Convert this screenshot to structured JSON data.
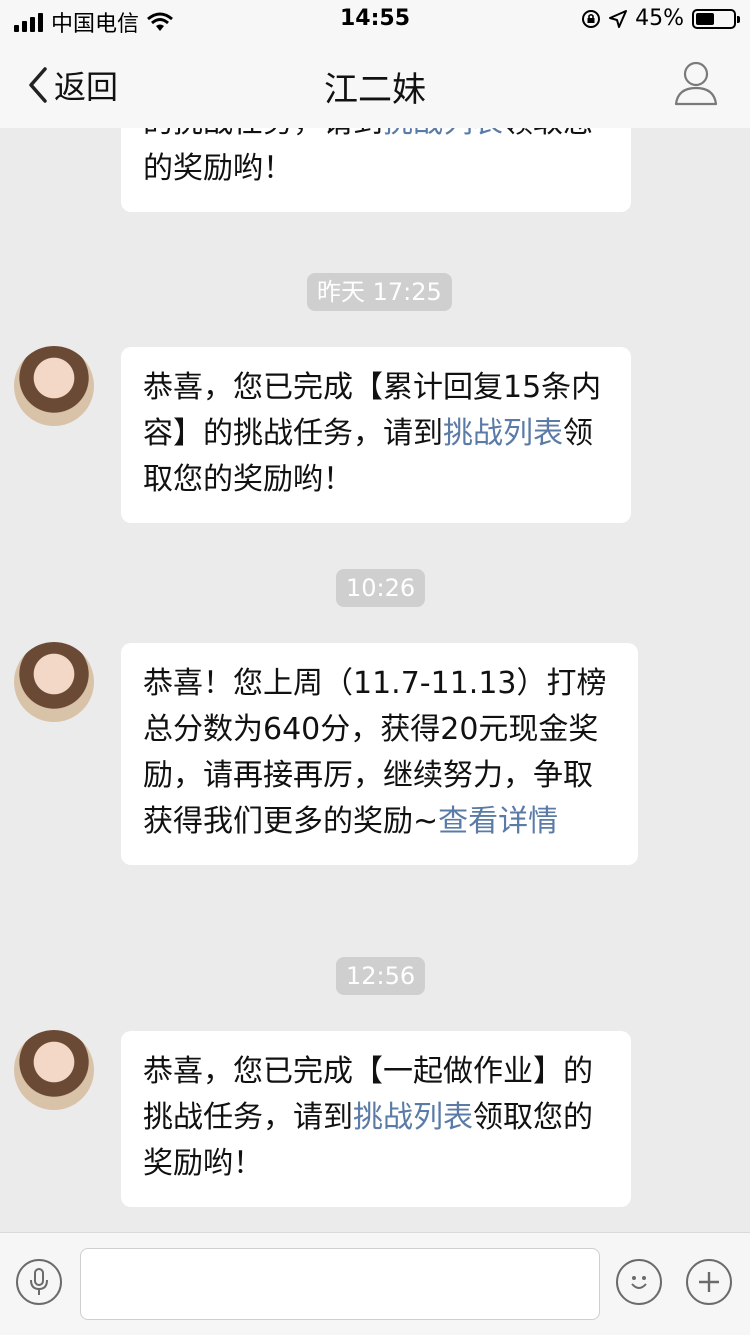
{
  "status_bar": {
    "carrier": "中国电信",
    "time": "14:55",
    "battery": "45%"
  },
  "nav": {
    "back_label": "返回",
    "title": "江二妹"
  },
  "messages": [
    {
      "timestamp": "",
      "segments": [
        {
          "text": "的挑战任务，请到",
          "link": false
        },
        {
          "text": "挑战列表",
          "link": true
        },
        {
          "text": "领取您的奖励哟！",
          "link": false
        }
      ]
    },
    {
      "timestamp": "昨天 17:25",
      "segments": [
        {
          "text": "恭喜，您已完成【累计回复15条内容】的挑战任务，请到",
          "link": false
        },
        {
          "text": "挑战列表",
          "link": true
        },
        {
          "text": "领取您的奖励哟！",
          "link": false
        }
      ]
    },
    {
      "timestamp": "10:26",
      "segments": [
        {
          "text": "恭喜！您上周（11.7-11.13）打榜总分数为640分，获得20元现金奖励，请再接再厉，继续努力，争取获得我们更多的奖励~",
          "link": false
        },
        {
          "text": "查看详情",
          "link": true
        }
      ]
    },
    {
      "timestamp": "12:56",
      "segments": [
        {
          "text": "恭喜，您已完成【一起做作业】的挑战任务，请到",
          "link": false
        },
        {
          "text": "挑战列表",
          "link": true
        },
        {
          "text": "领取您的奖励哟！",
          "link": false
        }
      ]
    }
  ],
  "input": {
    "value": ""
  },
  "icons": {
    "back": "chevron-left-icon",
    "profile": "person-icon",
    "voice": "microphone-icon",
    "emoji": "smiley-icon",
    "more": "plus-icon"
  },
  "colors": {
    "link": "#5b7ba7",
    "background": "#ebebeb",
    "bubble": "#ffffff",
    "timestamp_bg": "#cfcfcf"
  }
}
